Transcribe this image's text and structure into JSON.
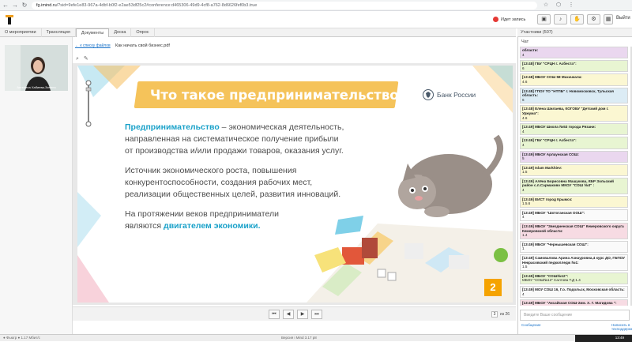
{
  "browser": {
    "url_host": "fg.imind.ru",
    "url_rest": "/?sid=9efe1e83-967a-4dbf-b0f2-e2ae53df25c2#conference:d465306-49d9-4cf8-a762-8d6626fef0b3.true",
    "back": "←",
    "forward": "→",
    "reload": "↻"
  },
  "header": {
    "rec_label": "Идет запись",
    "exit_label": "Выйти"
  },
  "tabs": [
    {
      "label": "О мероприятии"
    },
    {
      "label": "Трансляция"
    },
    {
      "label": "Документы"
    },
    {
      "label": "Доска"
    },
    {
      "label": "Опрос"
    }
  ],
  "participants_label": "Участники (507)",
  "left": {
    "video_name": "Ангелина Хабиева-Зинина"
  },
  "doc": {
    "back_link": "← к списку файлов",
    "file_name": "Как начать свой бизнес.pdf",
    "slide": {
      "title": "Что такое предпринимательство?",
      "bank": "Банк России",
      "p1_accent": "Предпринимательство",
      "p1_rest": " – экономическая деятельность,",
      "p1_l2": "направленная на систематическое получение прибыли",
      "p1_l3": "от производства и/или продажи товаров, оказания услуг.",
      "p2_l1": "Источник экономического роста, повышения",
      "p2_l2": "конкурентоспособности, создания рабочих мест,",
      "p2_l3": "реализации общественных целей, развития инноваций.",
      "p3_l1": "На протяжении веков предприниматели",
      "p3_l2_pre": "являются ",
      "p3_l2_accent": "двигателем экономики.",
      "number": "2"
    },
    "pager": {
      "first": "⏮",
      "prev": "◀",
      "next": "▶",
      "last": "⏭",
      "page": "3",
      "of": "из 26"
    }
  },
  "chat": {
    "header": "Чат",
    "messages": [
      {
        "color": "purple",
        "head": "области:",
        "body": "4"
      },
      {
        "color": "green",
        "head": "[13:48] ГБУ \"СРЦН г. Асбеста\":",
        "body": "6"
      },
      {
        "color": "yellow",
        "head": "[13:48] МБОУ СОШ 58 Махачкала:",
        "body": "4.6"
      },
      {
        "color": "blue",
        "head": "[13:48] ГПОУ ТО \"НТПБ\" г. Новомосковск, Тульская область:",
        "body": "6"
      },
      {
        "color": "yellow",
        "head": "[13:48] Елена Шилаева, КОГОБУ \"Детский дом г. Уржума\":",
        "body": "4.6"
      },
      {
        "color": "green",
        "head": "[13:49] МБОУ Школа №53 города Рязани:",
        "body": "4"
      },
      {
        "color": "green",
        "head": "[13:49] ГБУ \"СРЦН г. Асбеста\":",
        "body": "4"
      },
      {
        "color": "purple",
        "head": "[13:49] МБОУ Арлаунская СОШ:",
        "body": "5"
      },
      {
        "color": "yellow",
        "head": "[13:49] Islam Markhiev:",
        "body": "1.5"
      },
      {
        "color": "green",
        "head": "[13:49] Алёна Борисовна Машукова, КБР Зольский район с.п.Сармаково МКОУ \"СОШ №3\" :",
        "body": "4"
      },
      {
        "color": "yellow",
        "head": "[13:49] ЕИСТ город Крымск:",
        "body": "1.5.6"
      },
      {
        "color": "white",
        "head": "[13:49] МБОУ \"Шотоганская ООШ\":",
        "body": "4"
      },
      {
        "color": "pink",
        "head": "[13:49] МБОУ \"Звездненская СОШ\" Кемеровского округа Кемеровской области:",
        "body": "1.4"
      },
      {
        "color": "white",
        "head": "[13:49] МБОУ \"Чернышевская СОШ\":",
        "body": "1"
      },
      {
        "color": "white",
        "head": "[13:49] Самовалова Арина Азнауровна,4 курс ДО, ГБПОУ Некрасовский педколледж №1:",
        "body": "1.5"
      },
      {
        "color": "green",
        "head": "[13:49] МБОУ \"СОШ№12\":",
        "body": "МБОУ \"СОШ№12\" Салтова Т.Д 1.4"
      },
      {
        "color": "white",
        "head": "[13:49] МОУ СОШ 16, Г.о. Подольск, Московская область:",
        "body": "4"
      },
      {
        "color": "pink",
        "head": "[13:49] МБОУ \"Аксайская СОШ-2им. Х. Г. Магидова \":",
        "body": "1"
      }
    ],
    "input_placeholder": "Введите Ваше сообщение",
    "bottom_left": "Сообщение",
    "bottom_right": "Написать в техподдержку"
  },
  "status": {
    "left": "● Фьюгр  ● 1.17 Мбит/с",
    "mid": "Версия i Mind 3.17 р8",
    "time": "13:49"
  }
}
